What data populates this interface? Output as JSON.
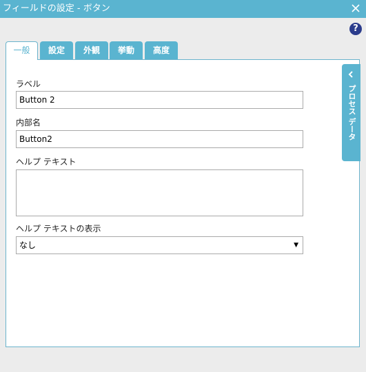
{
  "window": {
    "title": "フィールドの設定 - ボタン",
    "close_icon": "close-icon"
  },
  "help": {
    "label": "?"
  },
  "tabs": [
    {
      "label": "一般",
      "active": true
    },
    {
      "label": "設定",
      "active": false
    },
    {
      "label": "外観",
      "active": false
    },
    {
      "label": "挙動",
      "active": false
    },
    {
      "label": "高度",
      "active": false
    }
  ],
  "form": {
    "label_caption": "ラベル",
    "label_value": "Button 2",
    "internal_name_caption": "内部名",
    "internal_name_value": "Button2",
    "help_text_caption": "ヘルプ テキスト",
    "help_text_value": "",
    "help_display_caption": "ヘルプ テキストの表示",
    "help_display_value": "なし"
  },
  "side_panel": {
    "label": "プロセス データ"
  },
  "colors": {
    "accent": "#5ab4d0",
    "help": "#2b3c8c",
    "border": "#6ab3cc"
  }
}
